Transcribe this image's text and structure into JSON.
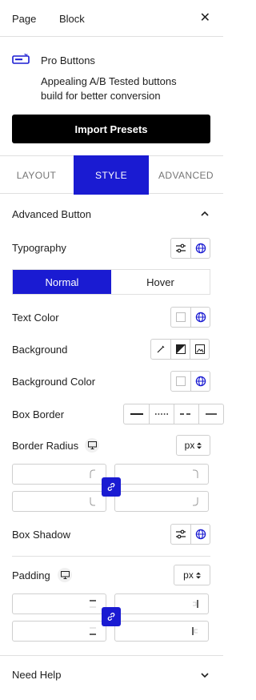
{
  "top_tabs": {
    "page": "Page",
    "block": "Block"
  },
  "block": {
    "name": "Pro Buttons",
    "description": "Appealing A/B Tested buttons build for better conversion",
    "import_label": "Import Presets"
  },
  "panel_tabs": {
    "layout": "LAYOUT",
    "style": "STYLE",
    "advanced": "ADVANCED"
  },
  "section": {
    "title": "Advanced Button"
  },
  "typography": {
    "label": "Typography"
  },
  "state_toggle": {
    "normal": "Normal",
    "hover": "Hover"
  },
  "text_color": {
    "label": "Text Color"
  },
  "background": {
    "label": "Background"
  },
  "background_color": {
    "label": "Background Color"
  },
  "box_border": {
    "label": "Box Border"
  },
  "border_radius": {
    "label": "Border Radius",
    "unit": "px"
  },
  "box_shadow": {
    "label": "Box Shadow"
  },
  "padding": {
    "label": "Padding",
    "unit": "px"
  },
  "help": {
    "label": "Need Help"
  },
  "colors": {
    "accent": "#1a1bd2",
    "wp_blue": "#3858e9",
    "black": "#000000"
  }
}
